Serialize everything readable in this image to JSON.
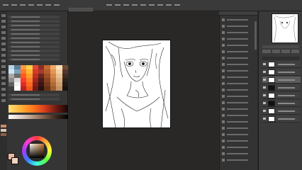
{
  "document": {
    "tab_label": "",
    "canvas_color": "#ffffff",
    "workspace_color": "#2a2827"
  },
  "colors": {
    "foreground": "#e9b8a0",
    "background": "#f3d2c0",
    "accent_orange": "#e8732b"
  },
  "color_set": [
    "#b7d3e6",
    "#5b7d98",
    "#ff9a3c",
    "#ffd04a",
    "#e0473a",
    "#8b2f25",
    "#c56b2e",
    "#f0a868",
    "#ffe0b8",
    "#6e4a33",
    "#cde5f1",
    "#7ba1bd",
    "#ff7a2a",
    "#ffb833",
    "#d43a2f",
    "#a83a2b",
    "#b45d2a",
    "#e39656",
    "#f6cfa4",
    "#53382a",
    "#a9a9a9",
    "#6a6a6a",
    "#ff5a1e",
    "#ff9b2a",
    "#c02f25",
    "#6a2620",
    "#9f4f24",
    "#d48748",
    "#eabf90",
    "#3f2c21",
    "#8c8c8c",
    "#d9d9d9",
    "#ff3b2b",
    "#ff7f27",
    "#a12620",
    "#4b1b18",
    "#8a4320",
    "#c2783c",
    "#dcae7f",
    "#2e2019",
    "#5e5e5e",
    "#f2f2f2",
    "#e02b24",
    "#ff6a20",
    "#82201b",
    "#3b1613",
    "#773a1c",
    "#b16a33",
    "#cf9f70",
    "#231913",
    "#3d3d3d",
    "#ffffff",
    "#b8231e",
    "#f0561b",
    "#6a1b17",
    "#2c110f",
    "#653118",
    "#9f5d2c",
    "#c29163",
    "#18120e"
  ],
  "icons": {
    "tools": "tool-icon",
    "wheel": "color-wheel-icon"
  }
}
